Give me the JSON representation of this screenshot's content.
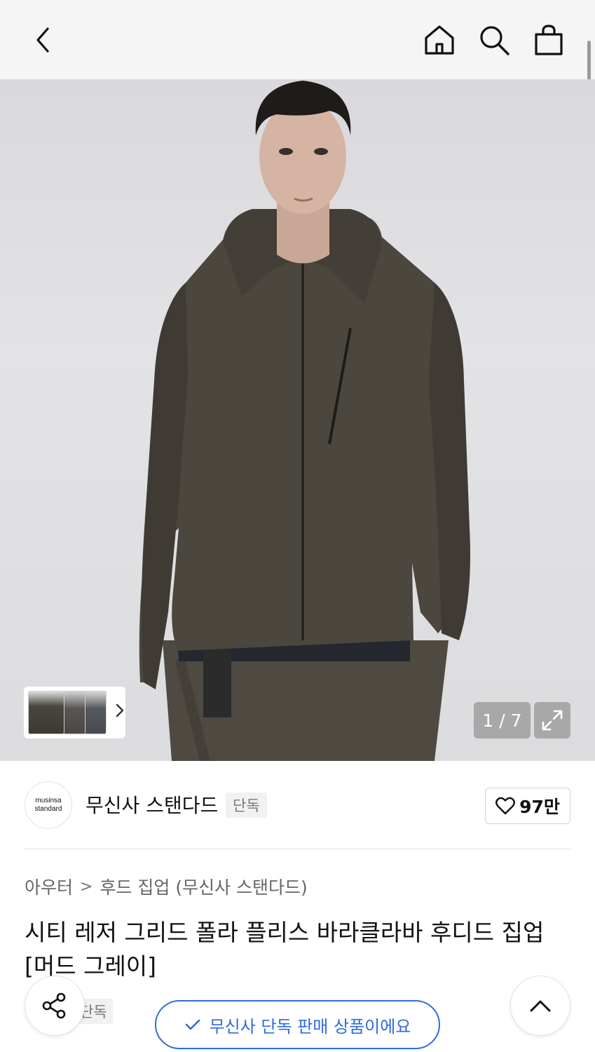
{
  "nav": {
    "back_icon": "chevron-left-icon",
    "home_icon": "home-icon",
    "search_icon": "search-icon",
    "cart_icon": "shopping-bag-icon"
  },
  "gallery": {
    "counter": "1 / 7",
    "current": 1,
    "total": 7,
    "expand_icon": "expand-icon",
    "thumbnails_next_icon": "chevron-right-icon"
  },
  "brand": {
    "logo_line1": "musinsa",
    "logo_line2": "standard",
    "name": "무신사 스탠다드",
    "tag": "단독",
    "like_count": "97만",
    "like_icon": "heart-icon"
  },
  "product": {
    "breadcrumb": [
      "아우터",
      "후드 집업 (무신사 스탠다드)"
    ],
    "breadcrumb_separator": ">",
    "title": "시티 레저 그리드 폴라 플리스 바라클라바 후디드 집업 [머드 그레이]",
    "tag": "단독"
  },
  "floating": {
    "share_icon": "share-icon",
    "scroll_top_icon": "chevron-up-icon",
    "exclusive_label": "무신사 단독 판매 상품이에요",
    "exclusive_icon": "check-icon"
  },
  "colors": {
    "accent_blue": "#2f6bdf",
    "topbar_bg": "#f5f5f5",
    "text_primary": "#111111",
    "text_muted": "#666666"
  }
}
